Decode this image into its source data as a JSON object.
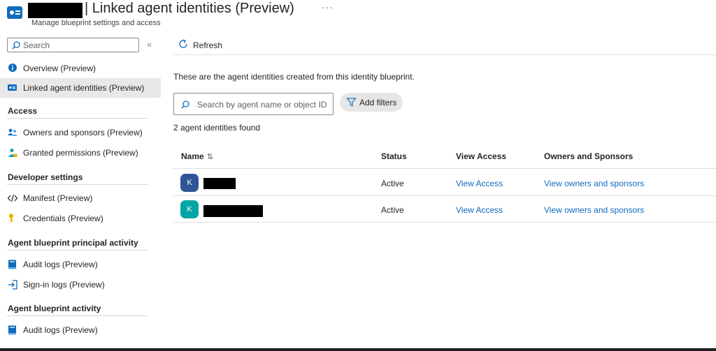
{
  "header": {
    "title": "| Linked agent identities (Preview)",
    "more": "···",
    "subtitle": "Manage blueprint settings and access"
  },
  "sidebar": {
    "search_placeholder": "Search",
    "collapse_icon": "«",
    "top_items": [
      {
        "label": "Overview (Preview)",
        "icon": "info-icon"
      },
      {
        "label": "Linked agent identities (Preview)",
        "icon": "id-card-icon",
        "active": true
      }
    ],
    "sections": [
      {
        "title": "Access",
        "items": [
          {
            "label": "Owners and sponsors (Preview)",
            "icon": "people-icon"
          },
          {
            "label": "Granted permissions (Preview)",
            "icon": "person-lock-icon"
          }
        ]
      },
      {
        "title": "Developer settings",
        "items": [
          {
            "label": "Manifest (Preview)",
            "icon": "code-icon"
          },
          {
            "label": "Credentials (Preview)",
            "icon": "key-icon"
          }
        ]
      },
      {
        "title": "Agent blueprint principal activity",
        "items": [
          {
            "label": "Audit logs (Preview)",
            "icon": "book-icon"
          },
          {
            "label": "Sign-in logs (Preview)",
            "icon": "sign-in-icon"
          }
        ]
      },
      {
        "title": "Agent blueprint activity",
        "items": [
          {
            "label": "Audit logs (Preview)",
            "icon": "book-icon"
          }
        ]
      }
    ]
  },
  "toolbar": {
    "refresh_label": "Refresh"
  },
  "main": {
    "description": "These are the agent identities created from this identity blueprint.",
    "search_placeholder": "Search by agent name or object ID",
    "add_filters_label": "Add filters",
    "count_text": "2 agent identities found"
  },
  "table": {
    "columns": [
      "Name",
      "Status",
      "View Access",
      "Owners and Sponsors"
    ],
    "sort_icon": "⇅",
    "rows": [
      {
        "avatar": "K",
        "avatar_color": "#2f5597",
        "status": "Active",
        "view_access": "View Access",
        "owners": "View owners and sponsors"
      },
      {
        "avatar": "K",
        "avatar_color": "#00a5a5",
        "status": "Active",
        "view_access": "View Access",
        "owners": "View owners and sponsors"
      }
    ]
  },
  "colors": {
    "accent": "#0f6cbd",
    "active_nav": "#e8e8e8"
  }
}
